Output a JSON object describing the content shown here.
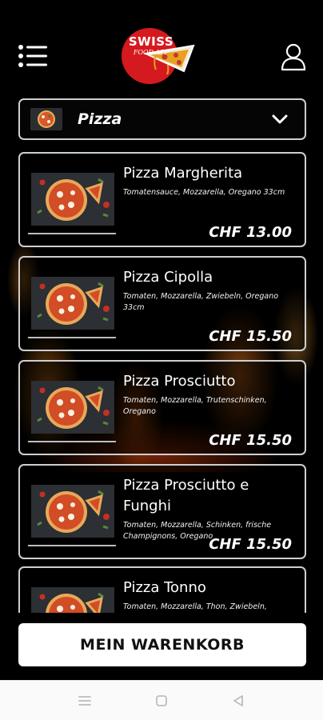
{
  "header": {
    "logo_line1": "SWISS",
    "logo_line2": "FOOD APP",
    "menu_icon": "menu-list-icon",
    "user_icon": "user-icon"
  },
  "category": {
    "selected": "Pizza",
    "icon": "chevron-down-icon"
  },
  "products": [
    {
      "name": "Pizza Margherita",
      "desc": "Tomatensauce, Mozzarella, Oregano 33cm",
      "price": "CHF 13.00"
    },
    {
      "name": "Pizza Cipolla",
      "desc": "Tomaten, Mozzarella, Zwiebeln, Oregano 33cm",
      "price": "CHF 15.50"
    },
    {
      "name": "Pizza Prosciutto",
      "desc": "Tomaten, Mozzarella, Trutenschinken, Oregano",
      "price": "CHF 15.50"
    },
    {
      "name": "Pizza Prosciutto e Funghi",
      "desc": "Tomaten, Mozzarella, Schinken, frische Champignons, Oregano",
      "price": "CHF 15.50"
    },
    {
      "name": "Pizza Tonno",
      "desc": "Tomaten, Mozzarella, Thon, Zwiebeln,",
      "price": ""
    }
  ],
  "cart_button": "MEIN WARENKORB",
  "colors": {
    "background": "#000000",
    "brand_red": "#d51a1f",
    "card_border": "#cfcfcf",
    "button_bg": "#ffffff"
  },
  "system_nav": {
    "icons": [
      "recents-icon",
      "home-icon",
      "back-icon"
    ]
  }
}
